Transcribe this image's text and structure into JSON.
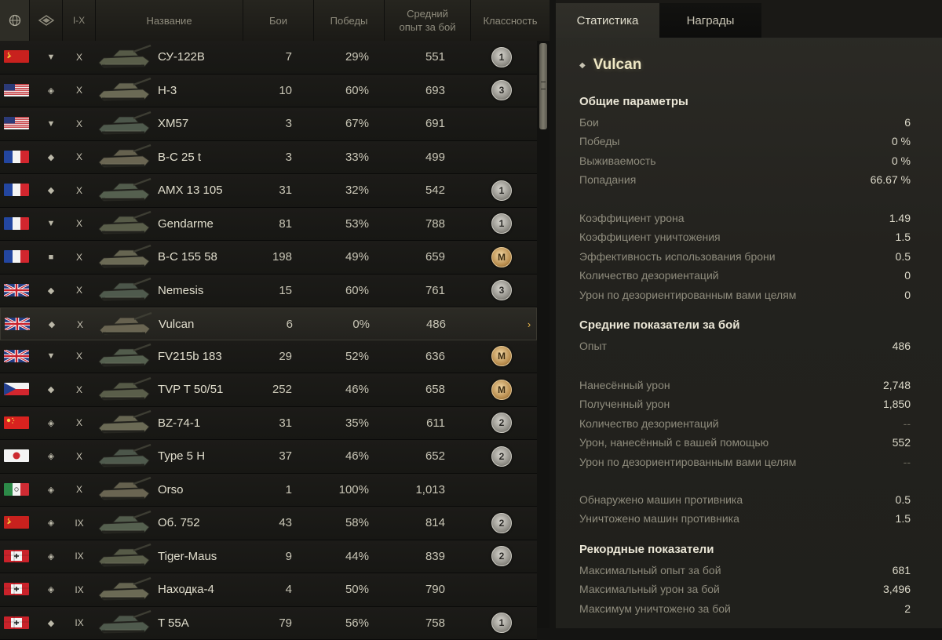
{
  "header": {
    "col_nation_icon": "globe-icon",
    "col_type_icon": "vehicle-type-icon",
    "col_tier": "I-X",
    "col_name": "Название",
    "col_battles": "Бои",
    "col_wins": "Победы",
    "col_avg_xp": "Средний опыт за бой",
    "col_mastery": "Классность"
  },
  "vehicles": [
    {
      "nation": "ussr",
      "type": "td",
      "tier": "X",
      "name": "СУ-122В",
      "battles": "7",
      "wins": "29%",
      "avg_xp": "551",
      "mastery": "1"
    },
    {
      "nation": "usa",
      "type": "medium",
      "tier": "X",
      "name": "H-3",
      "battles": "10",
      "wins": "60%",
      "avg_xp": "693",
      "mastery": "3"
    },
    {
      "nation": "usa",
      "type": "td",
      "tier": "X",
      "name": "XM57",
      "battles": "3",
      "wins": "67%",
      "avg_xp": "691",
      "mastery": ""
    },
    {
      "nation": "france",
      "type": "light",
      "tier": "X",
      "name": "B-C 25 t",
      "battles": "3",
      "wins": "33%",
      "avg_xp": "499",
      "mastery": ""
    },
    {
      "nation": "france",
      "type": "light",
      "tier": "X",
      "name": "AMX 13 105",
      "battles": "31",
      "wins": "32%",
      "avg_xp": "542",
      "mastery": "1"
    },
    {
      "nation": "france",
      "type": "td",
      "tier": "X",
      "name": "Gendarme",
      "battles": "81",
      "wins": "53%",
      "avg_xp": "788",
      "mastery": "1"
    },
    {
      "nation": "france",
      "type": "spg",
      "tier": "X",
      "name": "B-C 155 58",
      "battles": "198",
      "wins": "49%",
      "avg_xp": "659",
      "mastery": "M"
    },
    {
      "nation": "uk",
      "type": "light",
      "tier": "X",
      "name": "Nemesis",
      "battles": "15",
      "wins": "60%",
      "avg_xp": "761",
      "mastery": "3"
    },
    {
      "nation": "uk",
      "type": "light",
      "tier": "X",
      "name": "Vulcan",
      "battles": "6",
      "wins": "0%",
      "avg_xp": "486",
      "mastery": "",
      "selected": true
    },
    {
      "nation": "uk",
      "type": "td",
      "tier": "X",
      "name": "FV215b 183",
      "battles": "29",
      "wins": "52%",
      "avg_xp": "636",
      "mastery": "M"
    },
    {
      "nation": "czech",
      "type": "light",
      "tier": "X",
      "name": "TVP T 50/51",
      "battles": "252",
      "wins": "46%",
      "avg_xp": "658",
      "mastery": "M"
    },
    {
      "nation": "china",
      "type": "medium",
      "tier": "X",
      "name": "BZ-74-1",
      "battles": "31",
      "wins": "35%",
      "avg_xp": "611",
      "mastery": "2"
    },
    {
      "nation": "japan",
      "type": "medium",
      "tier": "X",
      "name": "Type 5 H",
      "battles": "37",
      "wins": "46%",
      "avg_xp": "652",
      "mastery": "2"
    },
    {
      "nation": "italy",
      "type": "medium",
      "tier": "X",
      "name": "Orso",
      "battles": "1",
      "wins": "100%",
      "avg_xp": "1,013",
      "mastery": ""
    },
    {
      "nation": "ussr",
      "type": "medium",
      "tier": "IX",
      "name": "Об. 752",
      "battles": "43",
      "wins": "58%",
      "avg_xp": "814",
      "mastery": "2"
    },
    {
      "nation": "germany",
      "type": "medium",
      "tier": "IX",
      "name": "Tiger-Maus",
      "battles": "9",
      "wins": "44%",
      "avg_xp": "839",
      "mastery": "2"
    },
    {
      "nation": "germany",
      "type": "medium",
      "tier": "IX",
      "name": "Находка-4",
      "battles": "4",
      "wins": "50%",
      "avg_xp": "790",
      "mastery": ""
    },
    {
      "nation": "germany",
      "type": "light",
      "tier": "IX",
      "name": "T 55A",
      "battles": "79",
      "wins": "56%",
      "avg_xp": "758",
      "mastery": "1"
    }
  ],
  "row_arrow": "›",
  "tabs": [
    {
      "label": "Статистика",
      "active": true
    },
    {
      "label": "Награды",
      "active": false
    }
  ],
  "stats": {
    "vehicle_name": "Vulcan",
    "general_title": "Общие параметры",
    "general": [
      {
        "label": "Бои",
        "value": "6"
      },
      {
        "label": "Победы",
        "value": "0 %"
      },
      {
        "label": "Выживаемость",
        "value": "0 %"
      },
      {
        "label": "Попадания",
        "value": "66.67 %"
      }
    ],
    "ratios": [
      {
        "label": "Коэффициент урона",
        "value": "1.49"
      },
      {
        "label": "Коэффициент уничтожения",
        "value": "1.5"
      },
      {
        "label": "Эффективность использования брони",
        "value": "0.5"
      },
      {
        "label": "Количество дезориентаций",
        "value": "0"
      },
      {
        "label": "Урон по дезориентированным вами целям",
        "value": "0"
      }
    ],
    "avg_title": "Средние показатели за бой",
    "avg": [
      {
        "label": "Опыт",
        "value": "486"
      }
    ],
    "damage": [
      {
        "label": "Нанесённый урон",
        "value": "2,748"
      },
      {
        "label": "Полученный урон",
        "value": "1,850"
      },
      {
        "label": "Количество дезориентаций",
        "value": "--"
      },
      {
        "label": "Урон, нанесённый с вашей помощью",
        "value": "552"
      },
      {
        "label": "Урон по дезориентированным вами целям",
        "value": "--"
      }
    ],
    "spotting": [
      {
        "label": "Обнаружено машин противника",
        "value": "0.5"
      },
      {
        "label": "Уничтожено машин противника",
        "value": "1.5"
      }
    ],
    "records_title": "Рекордные показатели",
    "records": [
      {
        "label": "Максимальный опыт за бой",
        "value": "681"
      },
      {
        "label": "Максимальный урон за бой",
        "value": "3,496"
      },
      {
        "label": "Максимум уничтожено за бой",
        "value": "2"
      }
    ]
  }
}
